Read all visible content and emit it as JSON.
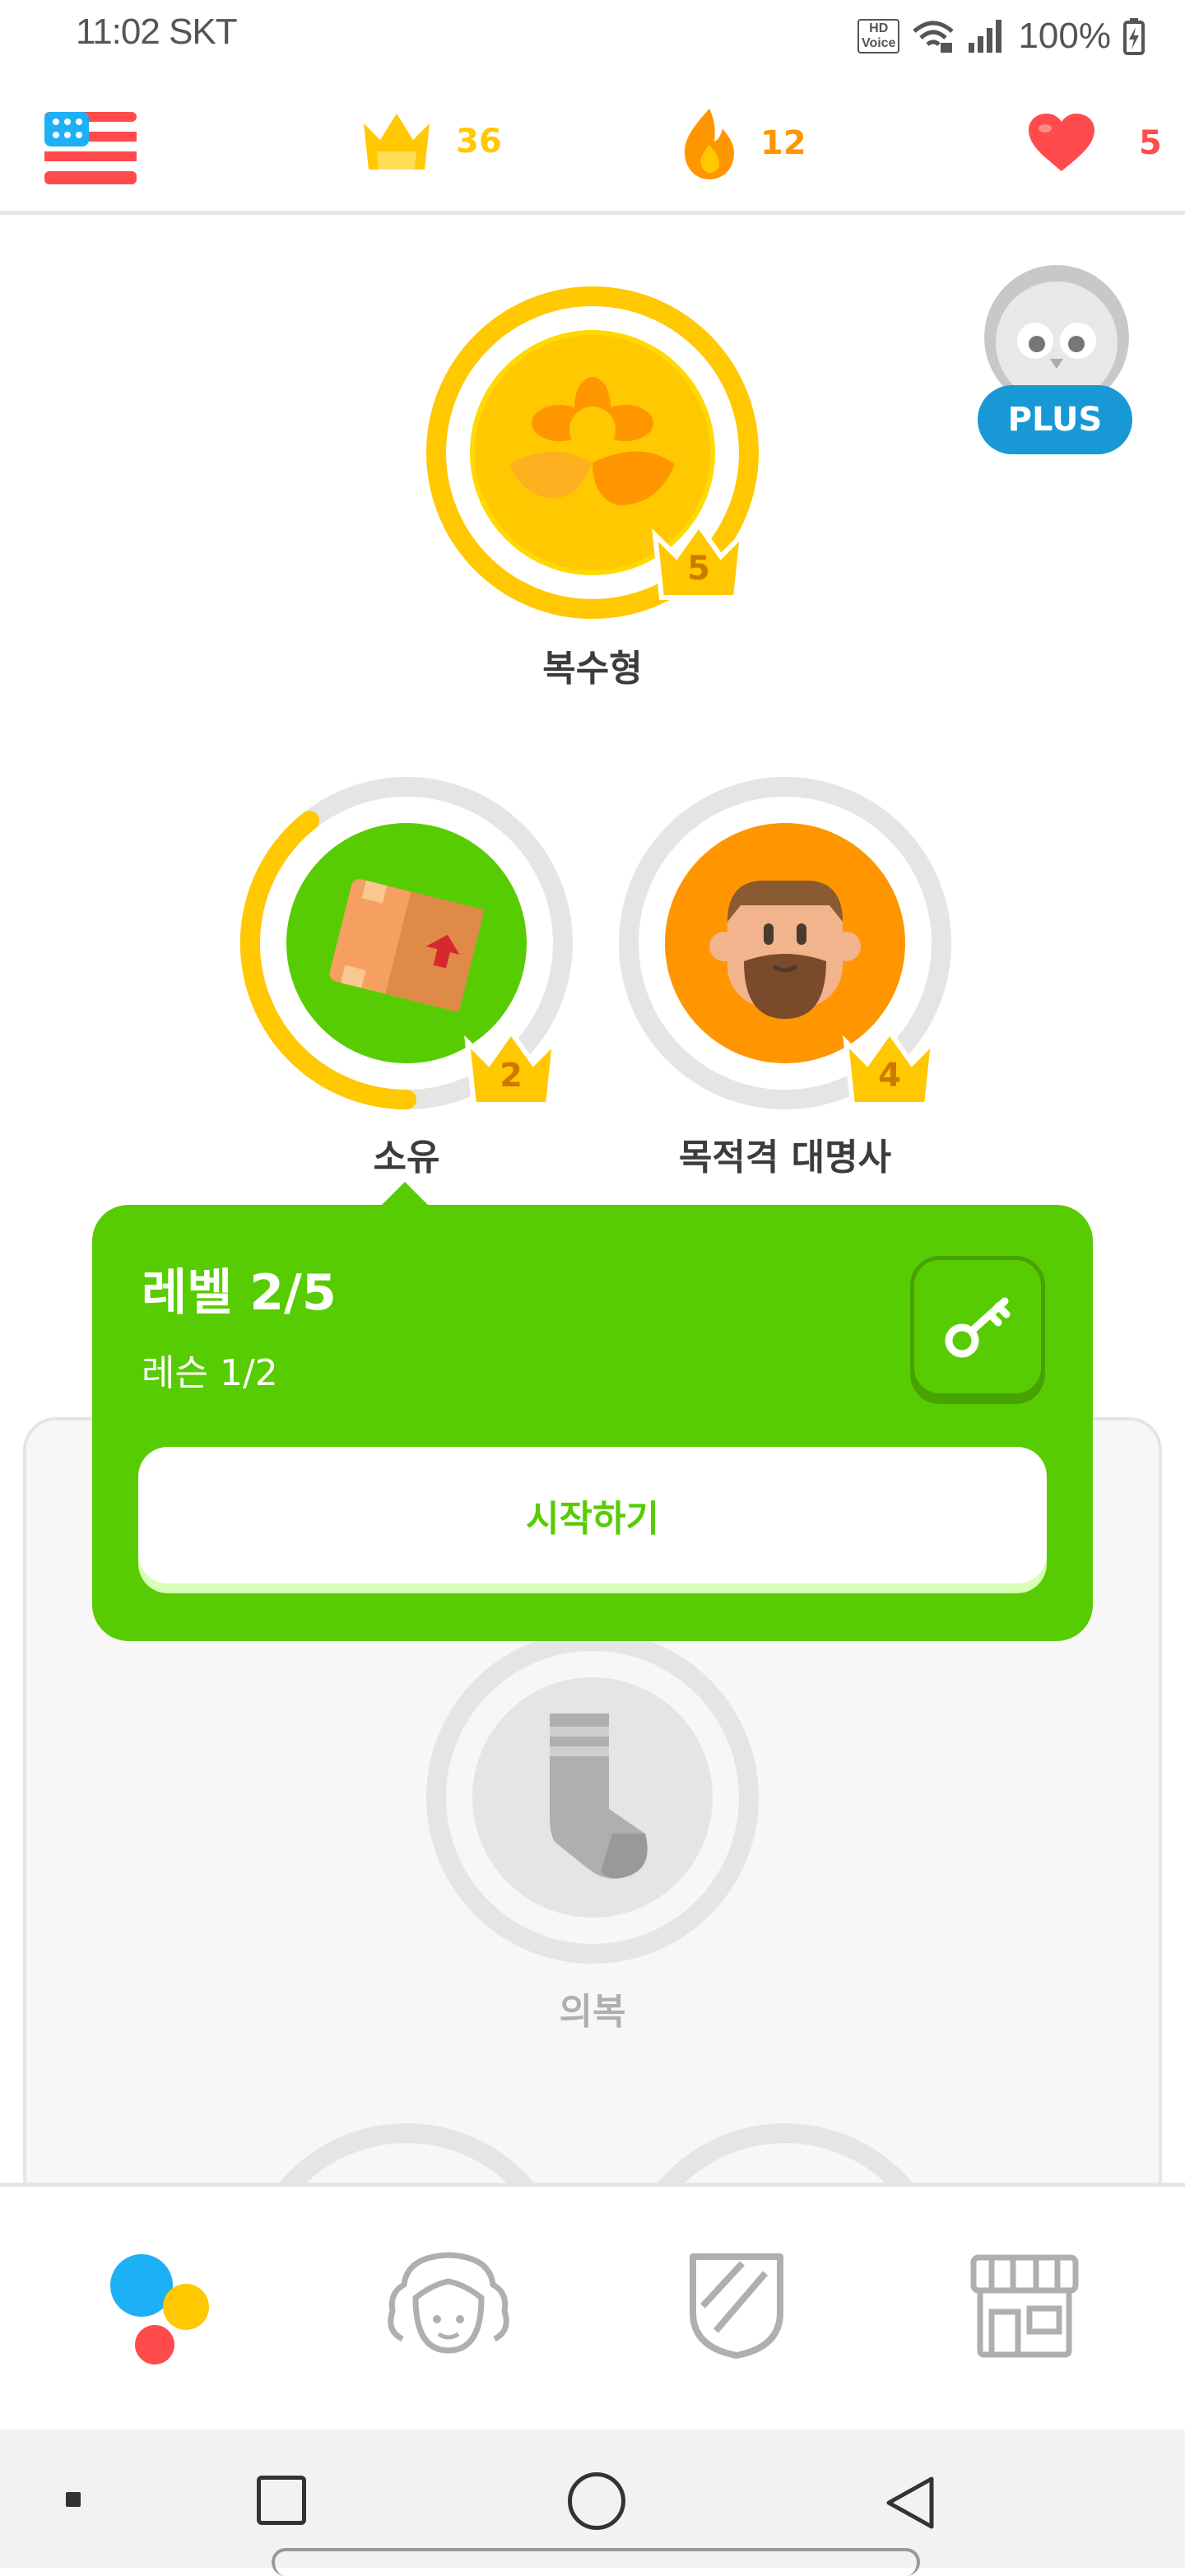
{
  "status_bar": {
    "time_carrier": "11:02 SKT",
    "hd_voice": "HD\nVoice",
    "battery": "100%"
  },
  "header": {
    "flag": "us-flag-icon",
    "crowns": "36",
    "streak": "12",
    "hearts": "5",
    "colors": {
      "crown": "#ffc800",
      "streak": "#ff9600",
      "heart": "#ff4b4b"
    }
  },
  "plus_badge": {
    "label": "PLUS",
    "color": "#1899d6"
  },
  "skills": [
    {
      "name": "복수형",
      "level": "5",
      "progress": 1.0,
      "color": "#ffc800"
    },
    {
      "name": "소유",
      "level": "2",
      "progress": 0.45,
      "color": "#58cc02"
    },
    {
      "name": "목적격 대명사",
      "level": "4",
      "progress": 0.0,
      "color": "#ff9600"
    },
    {
      "name": "의복",
      "level": "",
      "progress": 0.0,
      "color": "#e5e5e5",
      "locked": true
    }
  ],
  "popup": {
    "title": "레벨 2/5",
    "subtitle": "레슨 1/2",
    "start_label": "시작하기",
    "key_icon": "key-icon"
  },
  "bottom_nav": [
    {
      "name": "learn",
      "icon": "learn-dots-icon"
    },
    {
      "name": "profile",
      "icon": "profile-face-icon"
    },
    {
      "name": "leaderboards",
      "icon": "shield-icon"
    },
    {
      "name": "shop",
      "icon": "shop-icon"
    }
  ]
}
